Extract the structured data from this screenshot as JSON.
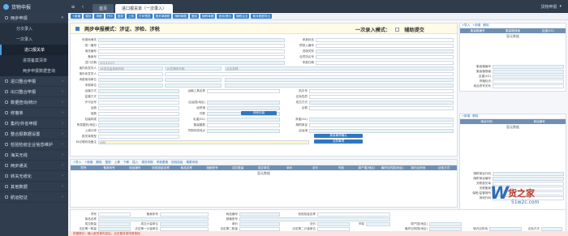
{
  "app": {
    "title": "货物申报",
    "user": "货物申报"
  },
  "top_tabs": [
    {
      "label": "首页"
    },
    {
      "label": "进口报关单（一次录入）"
    }
  ],
  "sidebar": {
    "items": [
      {
        "label": "两步申报",
        "expanded": true
      },
      {
        "label": "分次录入"
      },
      {
        "label": "一次录入"
      },
      {
        "label": "进口报关单",
        "active": true
      },
      {
        "label": "进境备案清单"
      },
      {
        "label": "两步申报数据查询"
      },
      {
        "label": "进口整合申报"
      },
      {
        "label": "出口整合申报"
      },
      {
        "label": "数据查询/统计"
      },
      {
        "label": "修撤单"
      },
      {
        "label": "集约/外省申报"
      },
      {
        "label": "整合报数据设置"
      },
      {
        "label": "检验检疫企业信息维护"
      },
      {
        "label": "海关无线"
      },
      {
        "label": "两步通关"
      },
      {
        "label": "转关无纸化"
      },
      {
        "label": "其他数据"
      },
      {
        "label": "航运担证"
      }
    ]
  },
  "toolbar": [
    "+新增",
    "暂存",
    "申报",
    "打印",
    "复制",
    "上传",
    "打印预览",
    "报关单随附",
    "随附单据",
    "复制",
    "随附单据",
    "查询/提示",
    "随附企业",
    "核对数据导出"
  ],
  "form": {
    "mode_title": "两步申报模式：涉证、涉检、涉税",
    "mode_right": "一次录入模式：",
    "assist_label": "辅助提交",
    "fields": [
      {
        "label": "申报地海关",
        "value": ""
      },
      {
        "label": "申报状态",
        "value": ""
      },
      {
        "label": "统一编号",
        "value": ""
      },
      {
        "label": "预录入编号",
        "value": ""
      },
      {
        "label": "海关编号",
        "value": ""
      },
      {
        "label": "进境关别",
        "value": ""
      },
      {
        "label": "备案号",
        "value": ""
      },
      {
        "label": "合同协议号",
        "value": ""
      },
      {
        "label": "进口日期",
        "value": "20191227"
      },
      {
        "label": "申报日期",
        "value": ""
      },
      {
        "label": "境内收发货人",
        "value": "18位社会信用代码"
      },
      {
        "label": "10位海关代码",
        "value": ""
      },
      {
        "label": "企业名称",
        "value": ""
      },
      {
        "label": "境外收发货人",
        "value": ""
      },
      {
        "label": "消费使用单位",
        "value": ""
      },
      {
        "label": "申报单位",
        "value": ""
      },
      {
        "label": "运输方式",
        "value": ""
      },
      {
        "label": "运输工具名称",
        "value": ""
      },
      {
        "label": "航次号",
        "value": ""
      },
      {
        "label": "监管方式",
        "value": ""
      },
      {
        "label": "征免性质",
        "value": ""
      },
      {
        "label": "许可证号",
        "value": ""
      },
      {
        "label": "启运国(地区)",
        "value": ""
      },
      {
        "label": "经停港",
        "value": ""
      },
      {
        "label": "成交方式",
        "value": ""
      },
      {
        "label": "运费",
        "value": ""
      },
      {
        "label": "保费",
        "value": ""
      },
      {
        "label": "杂费",
        "value": ""
      },
      {
        "label": "件数",
        "value": ""
      },
      {
        "label": "包装种类",
        "value": ""
      },
      {
        "label": "毛重(KG)",
        "value": ""
      },
      {
        "label": "净重(KG)",
        "value": ""
      },
      {
        "label": "贸易国别(地区)",
        "value": ""
      },
      {
        "label": "集装箱数",
        "value": ""
      },
      {
        "label": "随附单证",
        "value": ""
      },
      {
        "label": "入境口岸",
        "value": ""
      },
      {
        "label": "货物存放地点",
        "value": ""
      },
      {
        "label": "启运港",
        "value": ""
      },
      {
        "label": "报关单类型",
        "value": ""
      },
      {
        "label": "标记唛码及备注",
        "value": "N/M"
      }
    ],
    "buttons": {
      "other_items": "其他事项确认",
      "business_choice": "业务事项",
      "other": "其他包装"
    }
  },
  "right_panel1": {
    "tools": [
      "+导入",
      "+新增",
      "删除"
    ],
    "headers": [
      "集装箱编号",
      "集装箱规格",
      "自重(KG)"
    ],
    "empty": "暂无数据",
    "fields": [
      "集装箱编号",
      "集装箱规格",
      "自重(KG)",
      "拼箱标识",
      "商品项号关系"
    ]
  },
  "right_panel2": {
    "tools": [
      "+新增",
      "删除"
    ],
    "headers": [
      "单证代码",
      "单证编号"
    ],
    "empty": "暂无数据",
    "fields": [
      "随附单证代码",
      "随附单证编号",
      "关联报关单",
      "关联备案",
      "保税/监管场所",
      "场地代码"
    ]
  },
  "goods": {
    "tools": [
      "+导入",
      "+新增",
      "删除",
      "复制",
      "上移",
      "下移",
      "插入",
      "规范申报",
      "申报要素",
      "检验检疫",
      "概要申报"
    ],
    "headers": [
      "项号",
      "备案序号",
      "商品编号",
      "检验检疫名称",
      "商品名称",
      "规格型号",
      "成交数量",
      "成交单位",
      "单价",
      "总价",
      "币制",
      "原产国(地区)",
      "最终目的国(地区)",
      "境内目的地",
      "征免方式"
    ],
    "empty": "暂无数据"
  },
  "detail": {
    "fields": [
      "项号",
      "备案序号",
      "商品编号",
      "检验检疫名称",
      "商品名称",
      "规格型号",
      "成交数量",
      "成交计量单位",
      "单价",
      "总价",
      "币制",
      "法定第一数量",
      "法定第一计量单位",
      "法定第二数量",
      "法定第二计量单位",
      "原产国(地区)",
      "最终目的国(地区)",
      "境内目的地",
      "征免方式"
    ]
  },
  "footer": {
    "text": "申报提示：输入报关单内容后，点击暂存或申报按钮"
  },
  "watermark": {
    "mark": "W",
    "cn": "货之家",
    "url": "51w2c.com"
  }
}
